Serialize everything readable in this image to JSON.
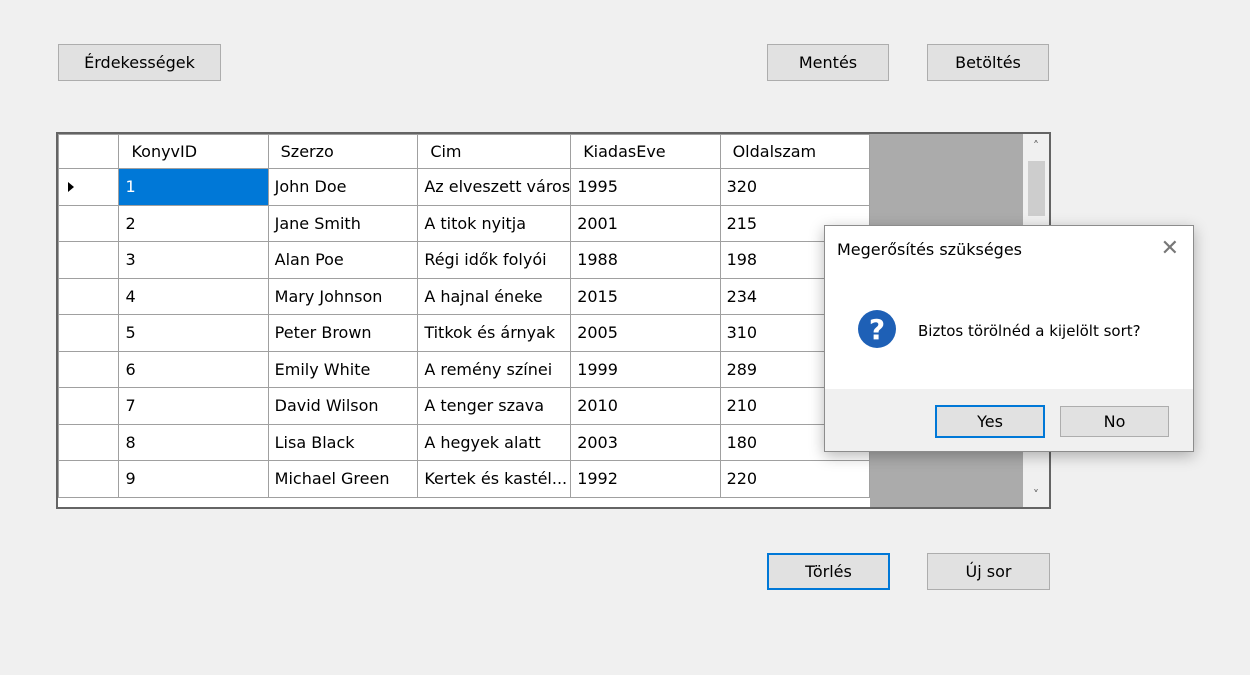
{
  "toolbar": {
    "interests_label": "Érdekességek",
    "save_label": "Mentés",
    "load_label": "Betöltés",
    "delete_label": "Törlés",
    "new_row_label": "Új sor"
  },
  "grid": {
    "columns": [
      "KonyvID",
      "Szerzo",
      "Cim",
      "KiadasEve",
      "Oldalszam"
    ],
    "rows": [
      [
        "1",
        "John Doe",
        "Az elveszett város",
        "1995",
        "320"
      ],
      [
        "2",
        "Jane Smith",
        "A titok nyitja",
        "2001",
        "215"
      ],
      [
        "3",
        "Alan Poe",
        "Régi idők folyói",
        "1988",
        "198"
      ],
      [
        "4",
        "Mary Johnson",
        "A hajnal éneke",
        "2015",
        "234"
      ],
      [
        "5",
        "Peter Brown",
        "Titkok és árnyak",
        "2005",
        "310"
      ],
      [
        "6",
        "Emily White",
        "A remény színei",
        "1999",
        "289"
      ],
      [
        "7",
        "David Wilson",
        "A tenger szava",
        "2010",
        "210"
      ],
      [
        "8",
        "Lisa Black",
        "A hegyek alatt",
        "2003",
        "180"
      ],
      [
        "9",
        "Michael Green",
        "Kertek és kastél...",
        "1992",
        "220"
      ]
    ],
    "selected_row": 0
  },
  "dialog": {
    "title": "Megerősítés szükséges",
    "close_glyph": "✕",
    "icon": "question-icon",
    "icon_glyph": "?",
    "message": "Biztos törölnéd a kijelölt sort?",
    "yes_label": "Yes",
    "no_label": "No"
  },
  "colors": {
    "selection": "#0078d7",
    "question_icon": "#1e60b6",
    "grid_background": "#ababab"
  }
}
